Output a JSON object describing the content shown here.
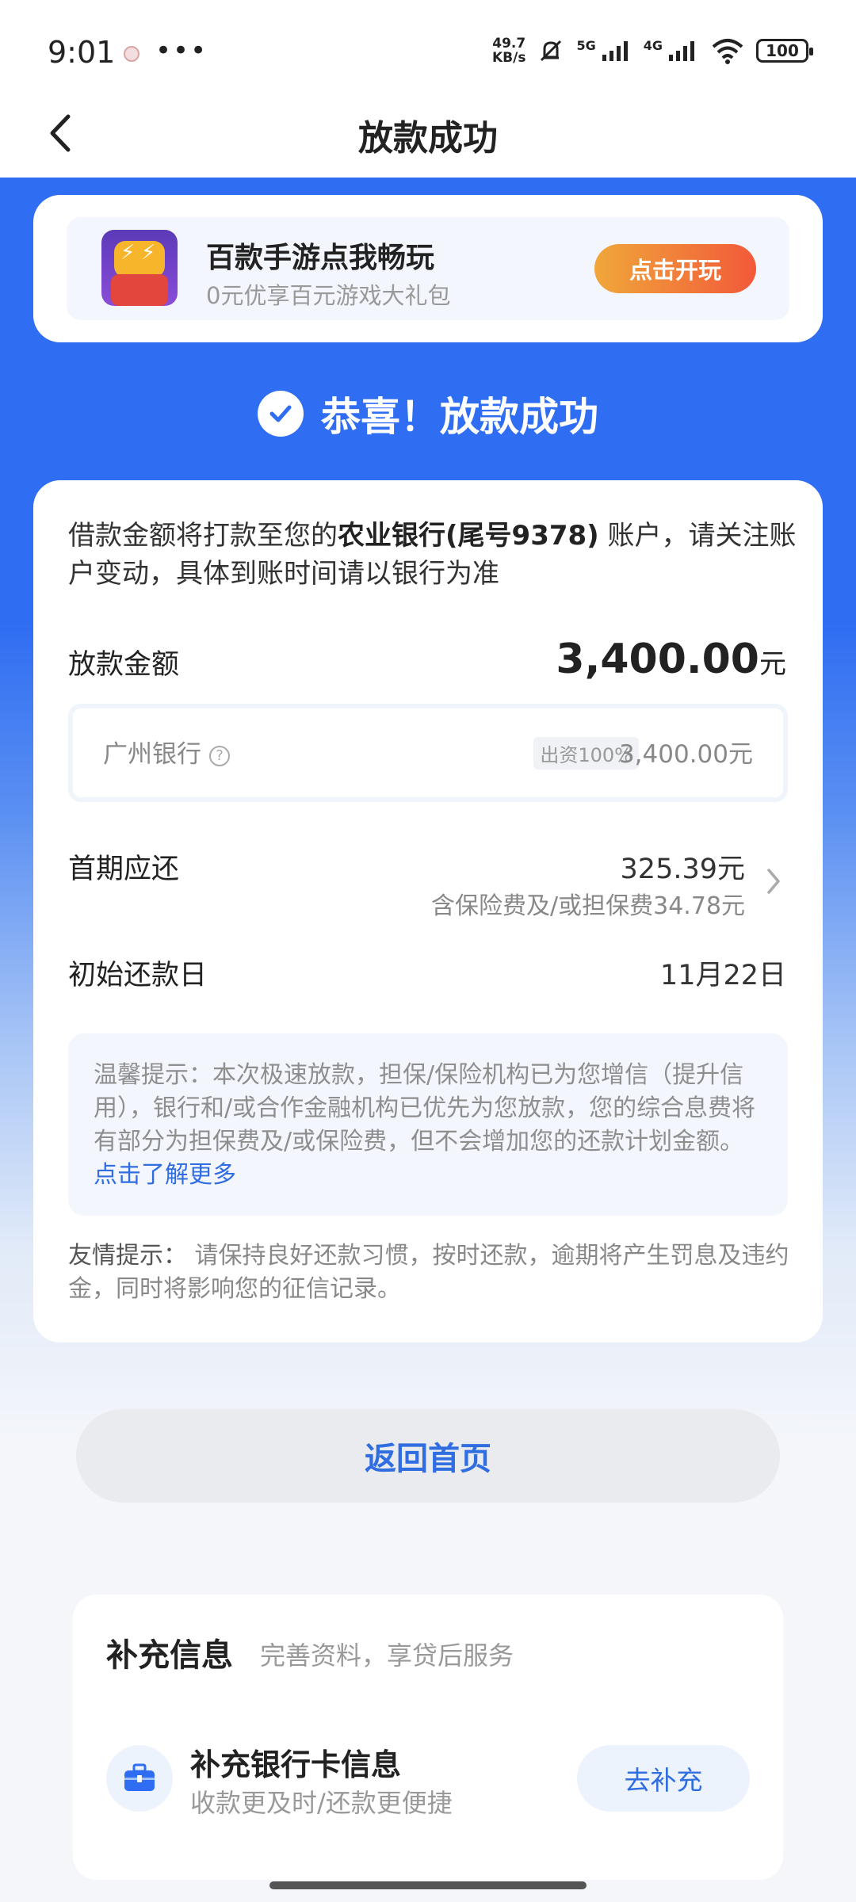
{
  "status_bar": {
    "time": "9:01",
    "net_speed_value": "49.7",
    "net_speed_unit": "KB/s",
    "signal_1": "5G",
    "signal_2": "4G",
    "battery": "100"
  },
  "nav": {
    "title": "放款成功",
    "back_icon": "chevron-left-icon"
  },
  "banner": {
    "title": "百款手游点我畅玩",
    "subtitle": "0元优享百元游戏大礼包",
    "button": "点击开玩"
  },
  "success": {
    "text": "恭喜！放款成功"
  },
  "notice": {
    "prefix": "借款金额将打款至您的",
    "bank": "农业银行(尾号9378)",
    "suffix": " 账户，请关注账户变动，具体到账时间请以银行为准"
  },
  "loan": {
    "label": "放款金额",
    "amount": "3,400.00",
    "unit": "元",
    "funder_name": "广州银行",
    "funder_share": "出资100%",
    "funder_amount": "3,400.00元"
  },
  "first_payment": {
    "label": "首期应还",
    "amount": "325.39元",
    "note": "含保险费及/或担保费34.78元"
  },
  "repay_date": {
    "label": "初始还款日",
    "value": "11月22日"
  },
  "tip": {
    "text": "温馨提示：本次极速放款，担保/保险机构已为您增信（提升信用），银行和/或合作金融机构已优先为您放款，您的综合息费将有部分为担保费及/或保险费，但不会增加您的还款计划金额。",
    "link": "点击了解更多"
  },
  "friendly": {
    "label": "友情提示：",
    "text": " 请保持良好还款习惯，按时还款，逾期将产生罚息及违约金，同时将影响您的征信记录。"
  },
  "home_button": "返回首页",
  "supplement": {
    "title": "补充信息",
    "subtitle": "完善资料，享贷后服务",
    "item_title": "补充银行卡信息",
    "item_subtitle": "收款更及时/还款更便捷",
    "item_button": "去补充"
  },
  "colors": {
    "primary_blue": "#2f6df2",
    "link_blue": "#2f6de0",
    "play_orange": "#f2593a"
  }
}
